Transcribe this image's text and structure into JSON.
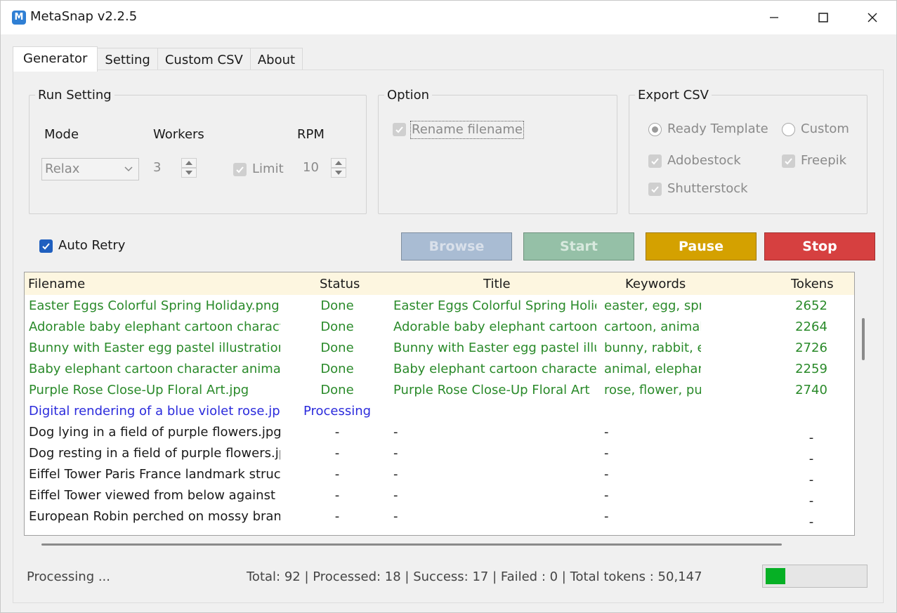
{
  "app": {
    "title": "MetaSnap v2.2.5",
    "icon": "metasnap-logo-icon"
  },
  "window_controls": {
    "minimize": "minimize-icon",
    "maximize": "maximize-icon",
    "close": "close-icon"
  },
  "tabs": [
    {
      "label": "Generator",
      "active": true
    },
    {
      "label": "Setting",
      "active": false
    },
    {
      "label": "Custom CSV",
      "active": false
    },
    {
      "label": "About",
      "active": false
    }
  ],
  "run_setting": {
    "legend": "Run Setting",
    "mode_label": "Mode",
    "mode_value": "Relax",
    "workers_label": "Workers",
    "workers_value": "3",
    "limit_label": "Limit",
    "limit_checked": true,
    "rpm_label": "RPM",
    "rpm_value": "10"
  },
  "option": {
    "legend": "Option",
    "rename_label": "Rename filename",
    "rename_checked": true
  },
  "export_csv": {
    "legend": "Export CSV",
    "ready_template_label": "Ready Template",
    "custom_label": "Custom",
    "selected": "Ready Template",
    "adobestock_label": "Adobestock",
    "freepik_label": "Freepik",
    "shutterstock_label": "Shutterstock"
  },
  "auto_retry": {
    "label": "Auto Retry",
    "checked": true
  },
  "buttons": {
    "browse": "Browse",
    "start": "Start",
    "pause": "Pause",
    "stop": "Stop"
  },
  "colors": {
    "browse_bg": "#a9bcd3",
    "start_bg": "#95c0a7",
    "pause_bg": "#d4a100",
    "stop_bg": "#d64040",
    "done_text": "#2a8a2a",
    "processing_text": "#2b2bdc",
    "pending_text": "#1a1a1a"
  },
  "table": {
    "columns": [
      "Filename",
      "Status",
      "Title",
      "Keywords",
      "Tokens"
    ],
    "rows": [
      {
        "state": "done",
        "filename": "Easter Eggs Colorful Spring Holiday.png",
        "status": "Done",
        "title": "Easter Eggs Colorful Spring Holiday",
        "keywords": "easter, egg, spring",
        "tokens": "2652"
      },
      {
        "state": "done",
        "filename": "Adorable baby elephant cartoon character",
        "status": "Done",
        "title": "Adorable baby elephant cartoon",
        "keywords": "cartoon, animal, elephant",
        "tokens": "2264"
      },
      {
        "state": "done",
        "filename": "Bunny with Easter egg pastel illustration.jpg",
        "status": "Done",
        "title": "Bunny with Easter egg pastel illustration",
        "keywords": "bunny, rabbit, easter",
        "tokens": "2726"
      },
      {
        "state": "done",
        "filename": "Baby elephant cartoon character animal.eps",
        "status": "Done",
        "title": "Baby elephant cartoon character",
        "keywords": "animal, elephant",
        "tokens": "2259"
      },
      {
        "state": "done",
        "filename": "Purple Rose Close-Up Floral Art.jpg",
        "status": "Done",
        "title": "Purple Rose Close-Up Floral Art",
        "keywords": "rose, flower, purple",
        "tokens": "2740"
      },
      {
        "state": "processing",
        "filename": "Digital rendering of a blue violet rose.jpg",
        "status": "Processing",
        "title": "",
        "keywords": "",
        "tokens": ""
      },
      {
        "state": "pending",
        "filename": "Dog lying in a field of purple flowers.jpg",
        "status": "-",
        "title": "-",
        "keywords": "-",
        "tokens": "-"
      },
      {
        "state": "pending",
        "filename": "Dog resting in a field of purple flowers.jpg",
        "status": "-",
        "title": "-",
        "keywords": "-",
        "tokens": "-"
      },
      {
        "state": "pending",
        "filename": "Eiffel Tower Paris France landmark structure",
        "status": "-",
        "title": "-",
        "keywords": "-",
        "tokens": "-"
      },
      {
        "state": "pending",
        "filename": "Eiffel Tower viewed from below against blue sky",
        "status": "-",
        "title": "-",
        "keywords": "-",
        "tokens": "-"
      },
      {
        "state": "pending",
        "filename": "European Robin perched on mossy branch",
        "status": "-",
        "title": "-",
        "keywords": "-",
        "tokens": "-"
      }
    ]
  },
  "status_bar": {
    "state": "Processing ...",
    "summary": "Total: 92 | Processed: 18 | Success: 17 | Failed : 0  | Total tokens : 50,147",
    "progress_fraction": 0.2
  }
}
